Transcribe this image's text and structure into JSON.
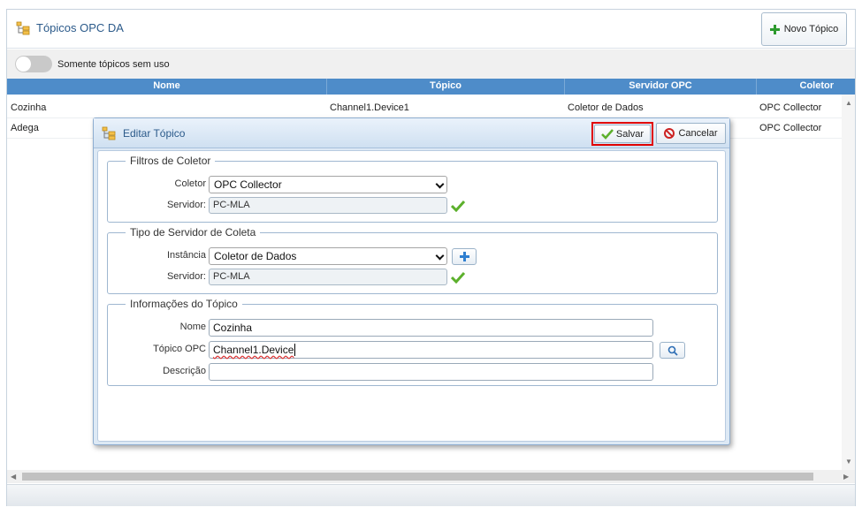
{
  "panel": {
    "title": "Tópicos OPC DA",
    "new_button_label": "Novo Tópico",
    "toggle_label": "Somente tópicos sem uso"
  },
  "table": {
    "columns": [
      "Nome",
      "Tópico",
      "Servidor OPC",
      "Coletor"
    ],
    "rows": [
      {
        "nome": "Cozinha",
        "topico": "Channel1.Device1",
        "servidor": "Coletor de Dados",
        "coletor": "OPC Collector"
      },
      {
        "nome": "Adega",
        "topico": "",
        "servidor": "",
        "coletor": "OPC Collector"
      }
    ]
  },
  "dialog": {
    "title": "Editar Tópico",
    "save_label": "Salvar",
    "cancel_label": "Cancelar",
    "filters": {
      "legend": "Filtros de Coletor",
      "coletor_label": "Coletor",
      "coletor_value": "OPC Collector",
      "servidor_label": "Servidor:",
      "servidor_value": "PC-MLA"
    },
    "server_type": {
      "legend": "Tipo de Servidor de Coleta",
      "instancia_label": "Instância",
      "instancia_value": "Coletor de Dados",
      "servidor_label": "Servidor:",
      "servidor_value": "PC-MLA"
    },
    "info": {
      "legend": "Informações do Tópico",
      "nome_label": "Nome",
      "nome_value": "Cozinha",
      "topico_label": "Tópico OPC",
      "topico_value": "Channel1.Device",
      "descricao_label": "Descrição",
      "descricao_value": ""
    }
  },
  "colors": {
    "header_blue": "#4e8cc9",
    "title_blue": "#2b5a8a",
    "highlight_red": "#e00000",
    "check_green": "#5cb02c"
  }
}
